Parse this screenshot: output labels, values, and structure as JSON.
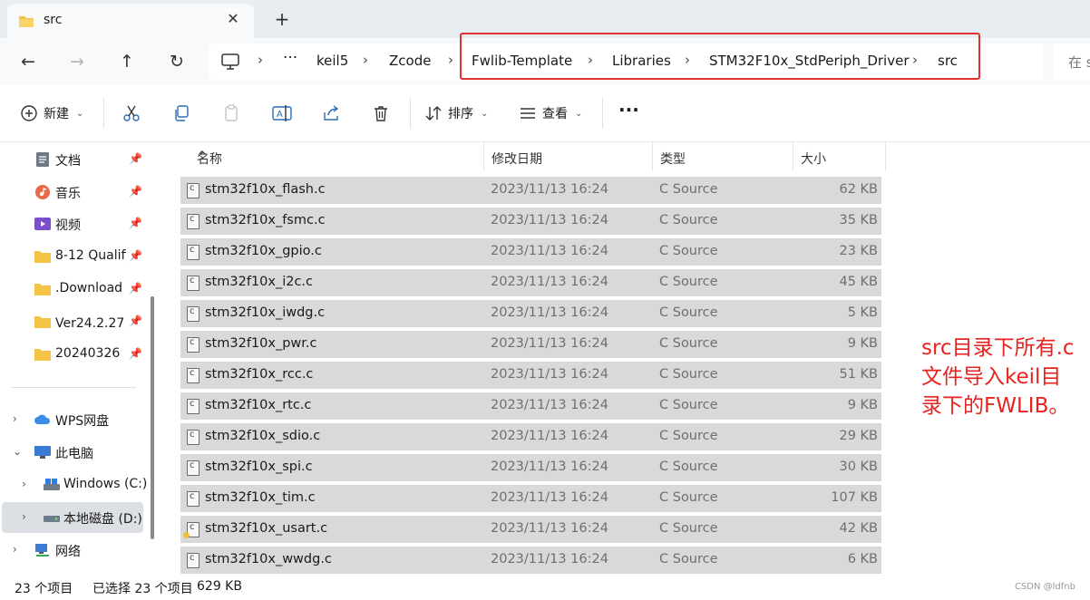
{
  "tab": {
    "title": "src",
    "close": "✕",
    "new": "+"
  },
  "nav": {
    "back": "←",
    "forward": "→",
    "up": "↑",
    "refresh": "↻",
    "overflow": "···"
  },
  "breadcrumb": [
    "keil5",
    "Zcode",
    "Fwlib-Template",
    "Libraries",
    "STM32F10x_StdPeriph_Driver",
    "src"
  ],
  "search": {
    "placeholder": "在 s"
  },
  "toolbar": {
    "new_label": "新建",
    "sort_label": "排序",
    "view_label": "查看",
    "more": "···"
  },
  "sidebar": {
    "quick": [
      {
        "label": "文档",
        "icon": "document-icon"
      },
      {
        "label": "音乐",
        "icon": "music-icon"
      },
      {
        "label": "视频",
        "icon": "video-icon"
      },
      {
        "label": "8-12 Qualifi",
        "icon": "folder-icon"
      },
      {
        "label": ".Download",
        "icon": "folder-icon"
      },
      {
        "label": "Ver24.2.27（",
        "icon": "folder-icon"
      },
      {
        "label": "20240326",
        "icon": "folder-icon"
      }
    ],
    "tree": [
      {
        "label": "WPS网盘",
        "icon": "cloud-icon",
        "chev": "›"
      },
      {
        "label": "此电脑",
        "icon": "pc-icon",
        "chev": "⌄"
      },
      {
        "label": "Windows (C:)",
        "icon": "drive-icon",
        "chev": "›"
      },
      {
        "label": "本地磁盘 (D:)",
        "icon": "drive-icon",
        "chev": "›"
      },
      {
        "label": "网络",
        "icon": "network-icon",
        "chev": "›"
      }
    ]
  },
  "columns": {
    "name": "名称",
    "date": "修改日期",
    "type": "类型",
    "size": "大小"
  },
  "files": [
    {
      "name": "stm32f10x_flash.c",
      "date": "2023/11/13 16:24",
      "type": "C Source",
      "size": "62 KB"
    },
    {
      "name": "stm32f10x_fsmc.c",
      "date": "2023/11/13 16:24",
      "type": "C Source",
      "size": "35 KB"
    },
    {
      "name": "stm32f10x_gpio.c",
      "date": "2023/11/13 16:24",
      "type": "C Source",
      "size": "23 KB"
    },
    {
      "name": "stm32f10x_i2c.c",
      "date": "2023/11/13 16:24",
      "type": "C Source",
      "size": "45 KB"
    },
    {
      "name": "stm32f10x_iwdg.c",
      "date": "2023/11/13 16:24",
      "type": "C Source",
      "size": "5 KB"
    },
    {
      "name": "stm32f10x_pwr.c",
      "date": "2023/11/13 16:24",
      "type": "C Source",
      "size": "9 KB"
    },
    {
      "name": "stm32f10x_rcc.c",
      "date": "2023/11/13 16:24",
      "type": "C Source",
      "size": "51 KB"
    },
    {
      "name": "stm32f10x_rtc.c",
      "date": "2023/11/13 16:24",
      "type": "C Source",
      "size": "9 KB"
    },
    {
      "name": "stm32f10x_sdio.c",
      "date": "2023/11/13 16:24",
      "type": "C Source",
      "size": "29 KB"
    },
    {
      "name": "stm32f10x_spi.c",
      "date": "2023/11/13 16:24",
      "type": "C Source",
      "size": "30 KB"
    },
    {
      "name": "stm32f10x_tim.c",
      "date": "2023/11/13 16:24",
      "type": "C Source",
      "size": "107 KB"
    },
    {
      "name": "stm32f10x_usart.c",
      "date": "2023/11/13 16:24",
      "type": "C Source",
      "size": "42 KB"
    },
    {
      "name": "stm32f10x_wwdg.c",
      "date": "2023/11/13 16:24",
      "type": "C Source",
      "size": "6 KB"
    }
  ],
  "annotation": [
    "src目录下所有.c",
    "文件导入keil目",
    "录下的FWLIB。"
  ],
  "status": {
    "count": "23 个项目",
    "selected": "已选择 23 个项目",
    "size": "629 KB"
  },
  "watermark": "CSDN @ldfnb",
  "colors": {
    "highlight": "#e33030",
    "annotation": "#e8231d",
    "selection": "#d9d9d9"
  }
}
